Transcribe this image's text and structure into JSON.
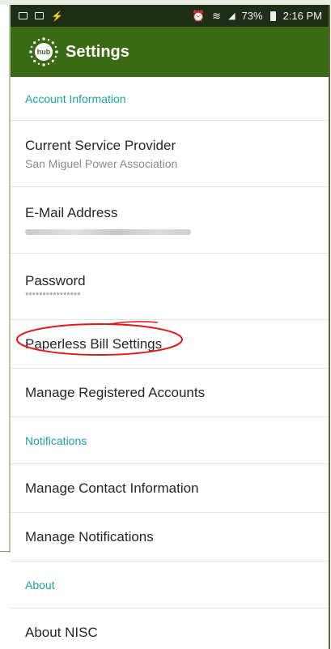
{
  "status_bar": {
    "battery": "73%",
    "time": "2:16 PM"
  },
  "app_bar": {
    "logo_text": "hub",
    "title": "Settings"
  },
  "sections": {
    "account": {
      "header": "Account Information",
      "current_provider": {
        "label": "Current Service Provider",
        "value": "San Miguel Power Association"
      },
      "email": {
        "label": "E-Mail Address"
      },
      "password": {
        "label": "Password",
        "value": "****************"
      },
      "paperless": {
        "label": "Paperless Bill Settings"
      },
      "registered_accounts": {
        "label": "Manage Registered Accounts"
      }
    },
    "notifications": {
      "header": "Notifications",
      "contact_info": {
        "label": "Manage Contact Information"
      },
      "manage_notifications": {
        "label": "Manage Notifications"
      }
    },
    "about": {
      "header": "About",
      "about_nisc": {
        "label": "About NISC"
      }
    }
  },
  "colors": {
    "status_bar": "#1d2d16",
    "app_bar": "#3a6a14",
    "section_header": "#1aa39a",
    "annotation": "#e01818"
  }
}
